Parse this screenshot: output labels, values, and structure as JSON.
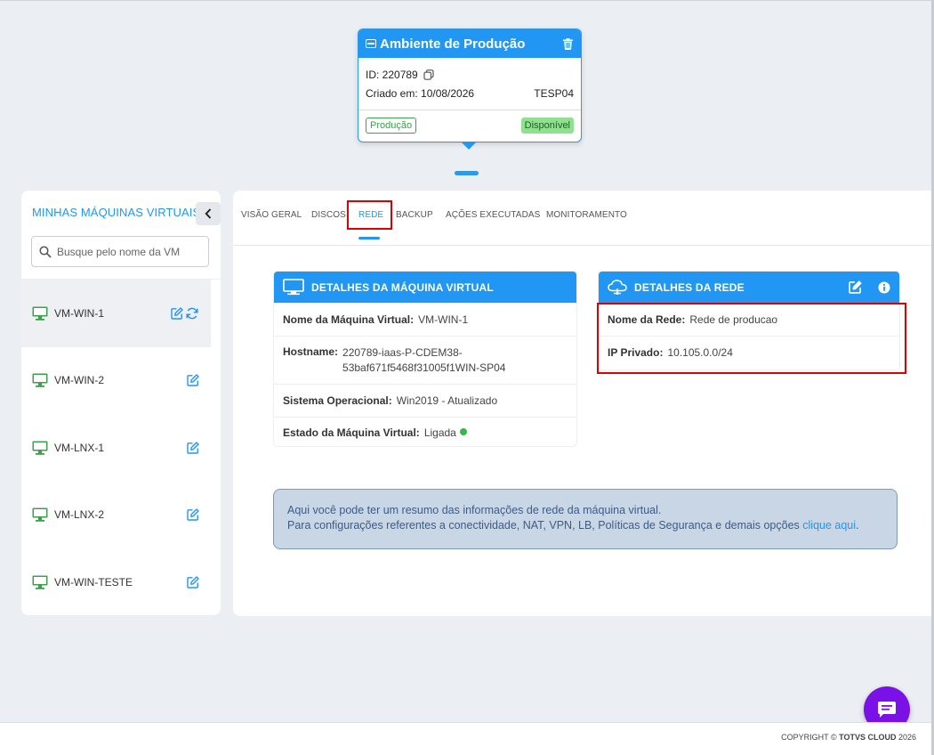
{
  "environment_card": {
    "title": "Ambiente de Produção",
    "id_label": "ID: 220789",
    "created_label": "Criado em: 10/08/2026",
    "code": "TESP04",
    "tag_env": "Produção",
    "tag_status": "Disponível"
  },
  "sidebar": {
    "title": "MINHAS MÁQUINAS VIRTUAIS",
    "search_placeholder": "Busque pelo nome da VM",
    "items": [
      {
        "label": "VM-WIN-1"
      },
      {
        "label": "VM-WIN-2"
      },
      {
        "label": "VM-LNX-1"
      },
      {
        "label": "VM-LNX-2"
      },
      {
        "label": "VM-WIN-TESTE"
      }
    ]
  },
  "tabs": [
    {
      "label": "VISÃO GERAL"
    },
    {
      "label": "DISCOS"
    },
    {
      "label": "REDE"
    },
    {
      "label": "BACKUP"
    },
    {
      "label": "AÇÕES EXECUTADAS"
    },
    {
      "label": "MONITORAMENTO"
    }
  ],
  "vm_details": {
    "title": "DETALHES DA MÁQUINA VIRTUAL",
    "name_key": "Nome da Máquina Virtual:",
    "name_value": "VM-WIN-1",
    "hostname_key": "Hostname:",
    "hostname_line1": "220789-iaas-P-CDEM38-",
    "hostname_line2": "53baf671f5468f31005f1WIN-SP04",
    "os_key": "Sistema Operacional:",
    "os_value": "Win2019 - Atualizado",
    "state_key": "Estado da Máquina Virtual:",
    "state_value": "Ligada"
  },
  "network_details": {
    "title": "DETALHES DA REDE",
    "net_key": "Nome da Rede:",
    "net_value": "Rede de producao",
    "ip_key": "IP Privado:",
    "ip_value": "10.105.0.0/24"
  },
  "info": {
    "line1": "Aqui você pode ter um resumo das informações de rede da máquina virtual.",
    "line2": "Para configurações referentes a conectividade, NAT, VPN, LB, Políticas de Segurança e demais opções",
    "link": "clique aqui",
    "period": "."
  },
  "footer": {
    "copyright_prefix": "COPYRIGHT ©",
    "brand": "TOTVS CLOUD",
    "year": "2026"
  },
  "colors": {
    "accent": "#2196f3",
    "vm_icon": "#3aa34a",
    "status_on": "#3ab54a",
    "chat": "#7a12e8",
    "highlight": "#e00000"
  }
}
